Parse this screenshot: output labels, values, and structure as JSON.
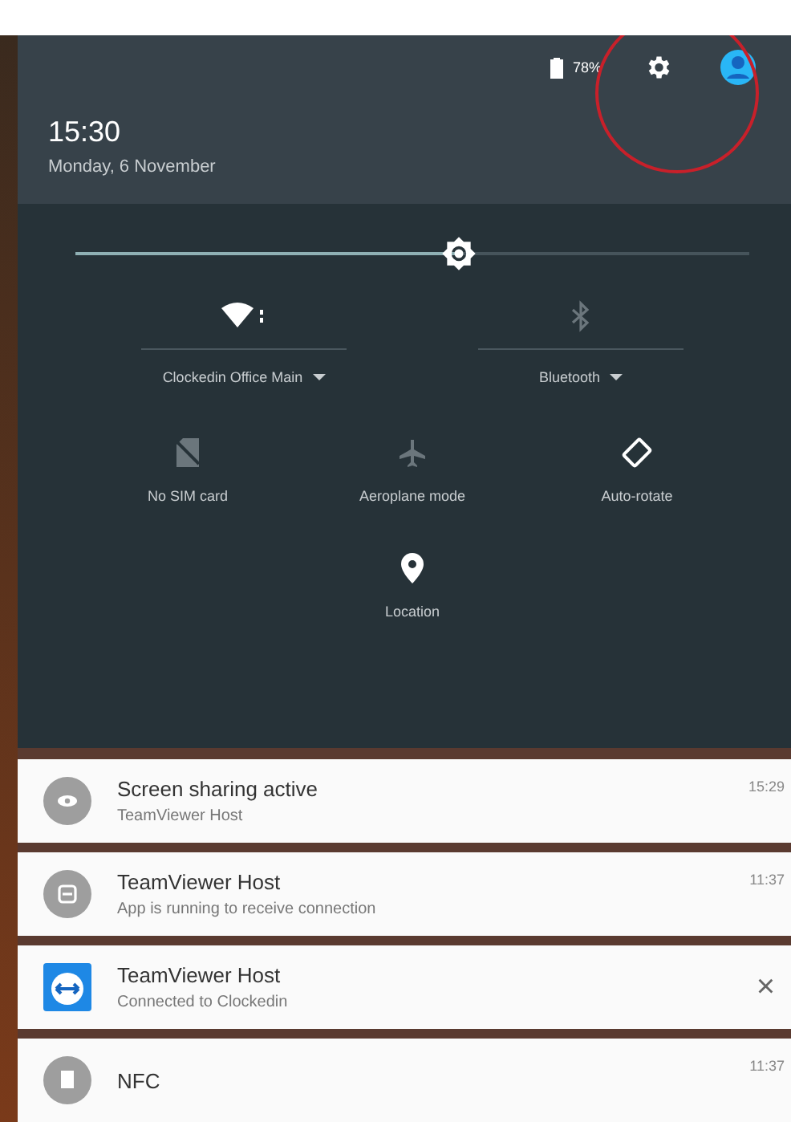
{
  "header": {
    "battery": "78%",
    "time": "15:30",
    "date": "Monday, 6 November"
  },
  "brightness": {
    "level": 0.57
  },
  "tiles": [
    {
      "kind": "wifi",
      "label": "Clockedin Office Main",
      "on": true
    },
    {
      "kind": "bluetooth",
      "label": "Bluetooth",
      "on": false
    },
    {
      "kind": "sim",
      "label": "No SIM card",
      "on": false
    },
    {
      "kind": "airplane",
      "label": "Aeroplane mode",
      "on": false
    },
    {
      "kind": "rotate",
      "label": "Auto-rotate",
      "on": true
    },
    {
      "kind": "location",
      "label": "Location",
      "on": true
    }
  ],
  "notifications": [
    {
      "kind": "eye",
      "title": "Screen sharing active",
      "text": "TeamViewer Host",
      "time": "15:29"
    },
    {
      "kind": "app",
      "title": "TeamViewer Host",
      "text": "App is running to receive connection",
      "time": "11:37"
    },
    {
      "kind": "logo",
      "title": "TeamViewer Host",
      "text": "Connected to Clockedin",
      "close": "×"
    },
    {
      "kind": "document",
      "title": "NFC",
      "time": "11:37"
    }
  ]
}
